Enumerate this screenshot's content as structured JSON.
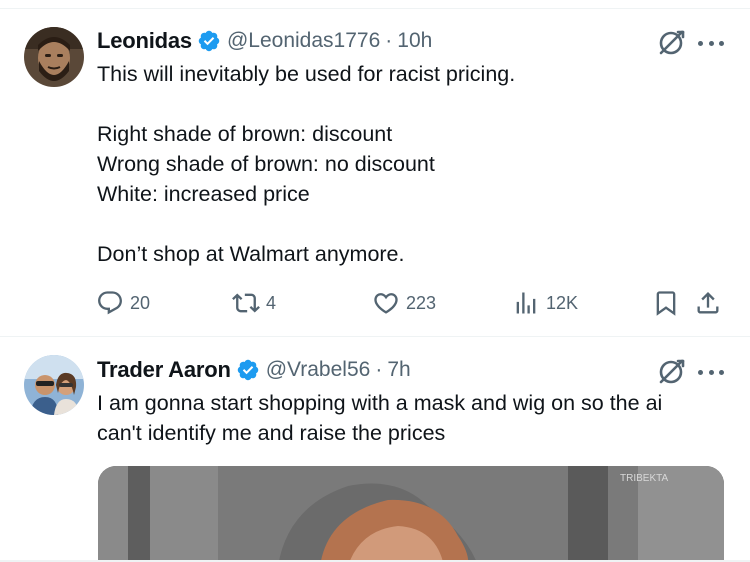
{
  "tweets": [
    {
      "name": "Leonidas",
      "handle": "@Leonidas1776",
      "separator": "·",
      "time": "10h",
      "text": "This will inevitably be used for racist pricing.\n\nRight shade of brown: discount\nWrong shade of brown: no discount\nWhite: increased price\n\nDon’t shop at Walmart anymore.",
      "actions": {
        "replies": "20",
        "retweets": "4",
        "likes": "223",
        "views": "12K"
      }
    },
    {
      "name": "Trader Aaron",
      "handle": "@Vrabel56",
      "separator": "·",
      "time": "7h",
      "text": "I am gonna start shopping with a mask and wig on so the ai\ncan't identify me and raise the prices",
      "media_watermark": "TRIBEKTA"
    }
  ],
  "icons": {
    "verified": "verified-badge-icon",
    "grok": "grok-icon",
    "more": "more-options-icon",
    "reply": "reply-icon",
    "retweet": "retweet-icon",
    "like": "heart-icon",
    "views": "views-chart-icon",
    "bookmark": "bookmark-icon",
    "share": "share-icon"
  },
  "colors": {
    "verified_blue": "#1d9bf0",
    "secondary_text": "#536471",
    "primary_text": "#0f1419"
  }
}
